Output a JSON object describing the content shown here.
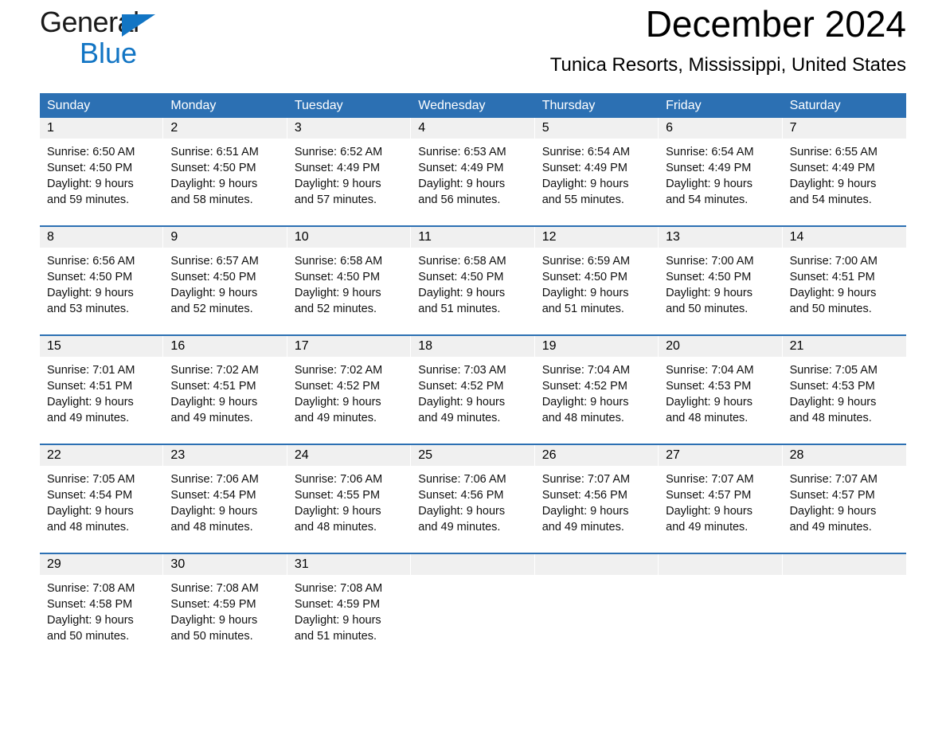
{
  "brand": {
    "name_part1": "General",
    "name_part2": "Blue",
    "accent_color": "#1275c4"
  },
  "header": {
    "month_title": "December 2024",
    "location": "Tunica Resorts, Mississippi, United States"
  },
  "theme": {
    "header_blue": "#2c70b3",
    "day_band_gray": "#f0f0f0"
  },
  "weekday_headers": [
    "Sunday",
    "Monday",
    "Tuesday",
    "Wednesday",
    "Thursday",
    "Friday",
    "Saturday"
  ],
  "weeks": [
    [
      {
        "day": "1",
        "sunrise": "Sunrise: 6:50 AM",
        "sunset": "Sunset: 4:50 PM",
        "daylight1": "Daylight: 9 hours",
        "daylight2": "and 59 minutes."
      },
      {
        "day": "2",
        "sunrise": "Sunrise: 6:51 AM",
        "sunset": "Sunset: 4:50 PM",
        "daylight1": "Daylight: 9 hours",
        "daylight2": "and 58 minutes."
      },
      {
        "day": "3",
        "sunrise": "Sunrise: 6:52 AM",
        "sunset": "Sunset: 4:49 PM",
        "daylight1": "Daylight: 9 hours",
        "daylight2": "and 57 minutes."
      },
      {
        "day": "4",
        "sunrise": "Sunrise: 6:53 AM",
        "sunset": "Sunset: 4:49 PM",
        "daylight1": "Daylight: 9 hours",
        "daylight2": "and 56 minutes."
      },
      {
        "day": "5",
        "sunrise": "Sunrise: 6:54 AM",
        "sunset": "Sunset: 4:49 PM",
        "daylight1": "Daylight: 9 hours",
        "daylight2": "and 55 minutes."
      },
      {
        "day": "6",
        "sunrise": "Sunrise: 6:54 AM",
        "sunset": "Sunset: 4:49 PM",
        "daylight1": "Daylight: 9 hours",
        "daylight2": "and 54 minutes."
      },
      {
        "day": "7",
        "sunrise": "Sunrise: 6:55 AM",
        "sunset": "Sunset: 4:49 PM",
        "daylight1": "Daylight: 9 hours",
        "daylight2": "and 54 minutes."
      }
    ],
    [
      {
        "day": "8",
        "sunrise": "Sunrise: 6:56 AM",
        "sunset": "Sunset: 4:50 PM",
        "daylight1": "Daylight: 9 hours",
        "daylight2": "and 53 minutes."
      },
      {
        "day": "9",
        "sunrise": "Sunrise: 6:57 AM",
        "sunset": "Sunset: 4:50 PM",
        "daylight1": "Daylight: 9 hours",
        "daylight2": "and 52 minutes."
      },
      {
        "day": "10",
        "sunrise": "Sunrise: 6:58 AM",
        "sunset": "Sunset: 4:50 PM",
        "daylight1": "Daylight: 9 hours",
        "daylight2": "and 52 minutes."
      },
      {
        "day": "11",
        "sunrise": "Sunrise: 6:58 AM",
        "sunset": "Sunset: 4:50 PM",
        "daylight1": "Daylight: 9 hours",
        "daylight2": "and 51 minutes."
      },
      {
        "day": "12",
        "sunrise": "Sunrise: 6:59 AM",
        "sunset": "Sunset: 4:50 PM",
        "daylight1": "Daylight: 9 hours",
        "daylight2": "and 51 minutes."
      },
      {
        "day": "13",
        "sunrise": "Sunrise: 7:00 AM",
        "sunset": "Sunset: 4:50 PM",
        "daylight1": "Daylight: 9 hours",
        "daylight2": "and 50 minutes."
      },
      {
        "day": "14",
        "sunrise": "Sunrise: 7:00 AM",
        "sunset": "Sunset: 4:51 PM",
        "daylight1": "Daylight: 9 hours",
        "daylight2": "and 50 minutes."
      }
    ],
    [
      {
        "day": "15",
        "sunrise": "Sunrise: 7:01 AM",
        "sunset": "Sunset: 4:51 PM",
        "daylight1": "Daylight: 9 hours",
        "daylight2": "and 49 minutes."
      },
      {
        "day": "16",
        "sunrise": "Sunrise: 7:02 AM",
        "sunset": "Sunset: 4:51 PM",
        "daylight1": "Daylight: 9 hours",
        "daylight2": "and 49 minutes."
      },
      {
        "day": "17",
        "sunrise": "Sunrise: 7:02 AM",
        "sunset": "Sunset: 4:52 PM",
        "daylight1": "Daylight: 9 hours",
        "daylight2": "and 49 minutes."
      },
      {
        "day": "18",
        "sunrise": "Sunrise: 7:03 AM",
        "sunset": "Sunset: 4:52 PM",
        "daylight1": "Daylight: 9 hours",
        "daylight2": "and 49 minutes."
      },
      {
        "day": "19",
        "sunrise": "Sunrise: 7:04 AM",
        "sunset": "Sunset: 4:52 PM",
        "daylight1": "Daylight: 9 hours",
        "daylight2": "and 48 minutes."
      },
      {
        "day": "20",
        "sunrise": "Sunrise: 7:04 AM",
        "sunset": "Sunset: 4:53 PM",
        "daylight1": "Daylight: 9 hours",
        "daylight2": "and 48 minutes."
      },
      {
        "day": "21",
        "sunrise": "Sunrise: 7:05 AM",
        "sunset": "Sunset: 4:53 PM",
        "daylight1": "Daylight: 9 hours",
        "daylight2": "and 48 minutes."
      }
    ],
    [
      {
        "day": "22",
        "sunrise": "Sunrise: 7:05 AM",
        "sunset": "Sunset: 4:54 PM",
        "daylight1": "Daylight: 9 hours",
        "daylight2": "and 48 minutes."
      },
      {
        "day": "23",
        "sunrise": "Sunrise: 7:06 AM",
        "sunset": "Sunset: 4:54 PM",
        "daylight1": "Daylight: 9 hours",
        "daylight2": "and 48 minutes."
      },
      {
        "day": "24",
        "sunrise": "Sunrise: 7:06 AM",
        "sunset": "Sunset: 4:55 PM",
        "daylight1": "Daylight: 9 hours",
        "daylight2": "and 48 minutes."
      },
      {
        "day": "25",
        "sunrise": "Sunrise: 7:06 AM",
        "sunset": "Sunset: 4:56 PM",
        "daylight1": "Daylight: 9 hours",
        "daylight2": "and 49 minutes."
      },
      {
        "day": "26",
        "sunrise": "Sunrise: 7:07 AM",
        "sunset": "Sunset: 4:56 PM",
        "daylight1": "Daylight: 9 hours",
        "daylight2": "and 49 minutes."
      },
      {
        "day": "27",
        "sunrise": "Sunrise: 7:07 AM",
        "sunset": "Sunset: 4:57 PM",
        "daylight1": "Daylight: 9 hours",
        "daylight2": "and 49 minutes."
      },
      {
        "day": "28",
        "sunrise": "Sunrise: 7:07 AM",
        "sunset": "Sunset: 4:57 PM",
        "daylight1": "Daylight: 9 hours",
        "daylight2": "and 49 minutes."
      }
    ],
    [
      {
        "day": "29",
        "sunrise": "Sunrise: 7:08 AM",
        "sunset": "Sunset: 4:58 PM",
        "daylight1": "Daylight: 9 hours",
        "daylight2": "and 50 minutes."
      },
      {
        "day": "30",
        "sunrise": "Sunrise: 7:08 AM",
        "sunset": "Sunset: 4:59 PM",
        "daylight1": "Daylight: 9 hours",
        "daylight2": "and 50 minutes."
      },
      {
        "day": "31",
        "sunrise": "Sunrise: 7:08 AM",
        "sunset": "Sunset: 4:59 PM",
        "daylight1": "Daylight: 9 hours",
        "daylight2": "and 51 minutes."
      },
      {
        "day": "",
        "sunrise": "",
        "sunset": "",
        "daylight1": "",
        "daylight2": ""
      },
      {
        "day": "",
        "sunrise": "",
        "sunset": "",
        "daylight1": "",
        "daylight2": ""
      },
      {
        "day": "",
        "sunrise": "",
        "sunset": "",
        "daylight1": "",
        "daylight2": ""
      },
      {
        "day": "",
        "sunrise": "",
        "sunset": "",
        "daylight1": "",
        "daylight2": ""
      }
    ]
  ]
}
